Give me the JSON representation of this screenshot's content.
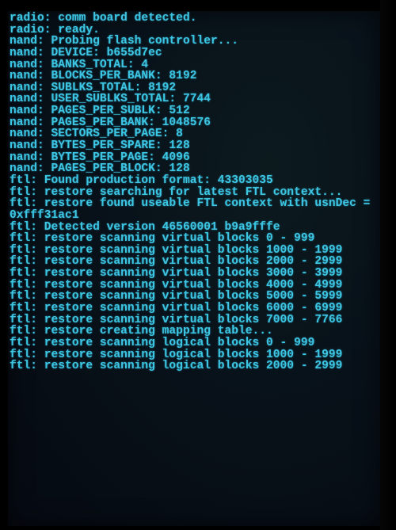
{
  "console": {
    "text_color": "#3cc6e4",
    "background_color": "#08121a",
    "lines": [
      "radio: comm board detected.",
      "radio: ready.",
      "nand: Probing flash controller...",
      "nand: DEVICE: b655d7ec",
      "nand: BANKS_TOTAL: 4",
      "nand: BLOCKS_PER_BANK: 8192",
      "nand: SUBLKS_TOTAL: 8192",
      "nand: USER_SUBLKS_TOTAL: 7744",
      "nand: PAGES_PER_SUBLK: 512",
      "nand: PAGES_PER_BANK: 1048576",
      "nand: SECTORS_PER_PAGE: 8",
      "nand: BYTES_PER_SPARE: 128",
      "nand: BYTES_PER_PAGE: 4096",
      "nand: PAGES_PER_BLOCK: 128",
      "ftl: Found production format: 43303035",
      "ftl: restore searching for latest FTL context...",
      "ftl: restore found useable FTL context with usnDec =",
      "0xfff31ac1",
      "ftl: Detected version 46560001 b9a9fffe",
      "ftl: restore scanning virtual blocks 0 - 999",
      "ftl: restore scanning virtual blocks 1000 - 1999",
      "ftl: restore scanning virtual blocks 2000 - 2999",
      "ftl: restore scanning virtual blocks 3000 - 3999",
      "ftl: restore scanning virtual blocks 4000 - 4999",
      "ftl: restore scanning virtual blocks 5000 - 5999",
      "ftl: restore scanning virtual blocks 6000 - 6999",
      "ftl: restore scanning virtual blocks 7000 - 7766",
      "ftl: restore creating mapping table...",
      "ftl: restore scanning logical blocks 0 - 999",
      "ftl: restore scanning logical blocks 1000 - 1999",
      "ftl: restore scanning logical blocks 2000 - 2999"
    ]
  }
}
